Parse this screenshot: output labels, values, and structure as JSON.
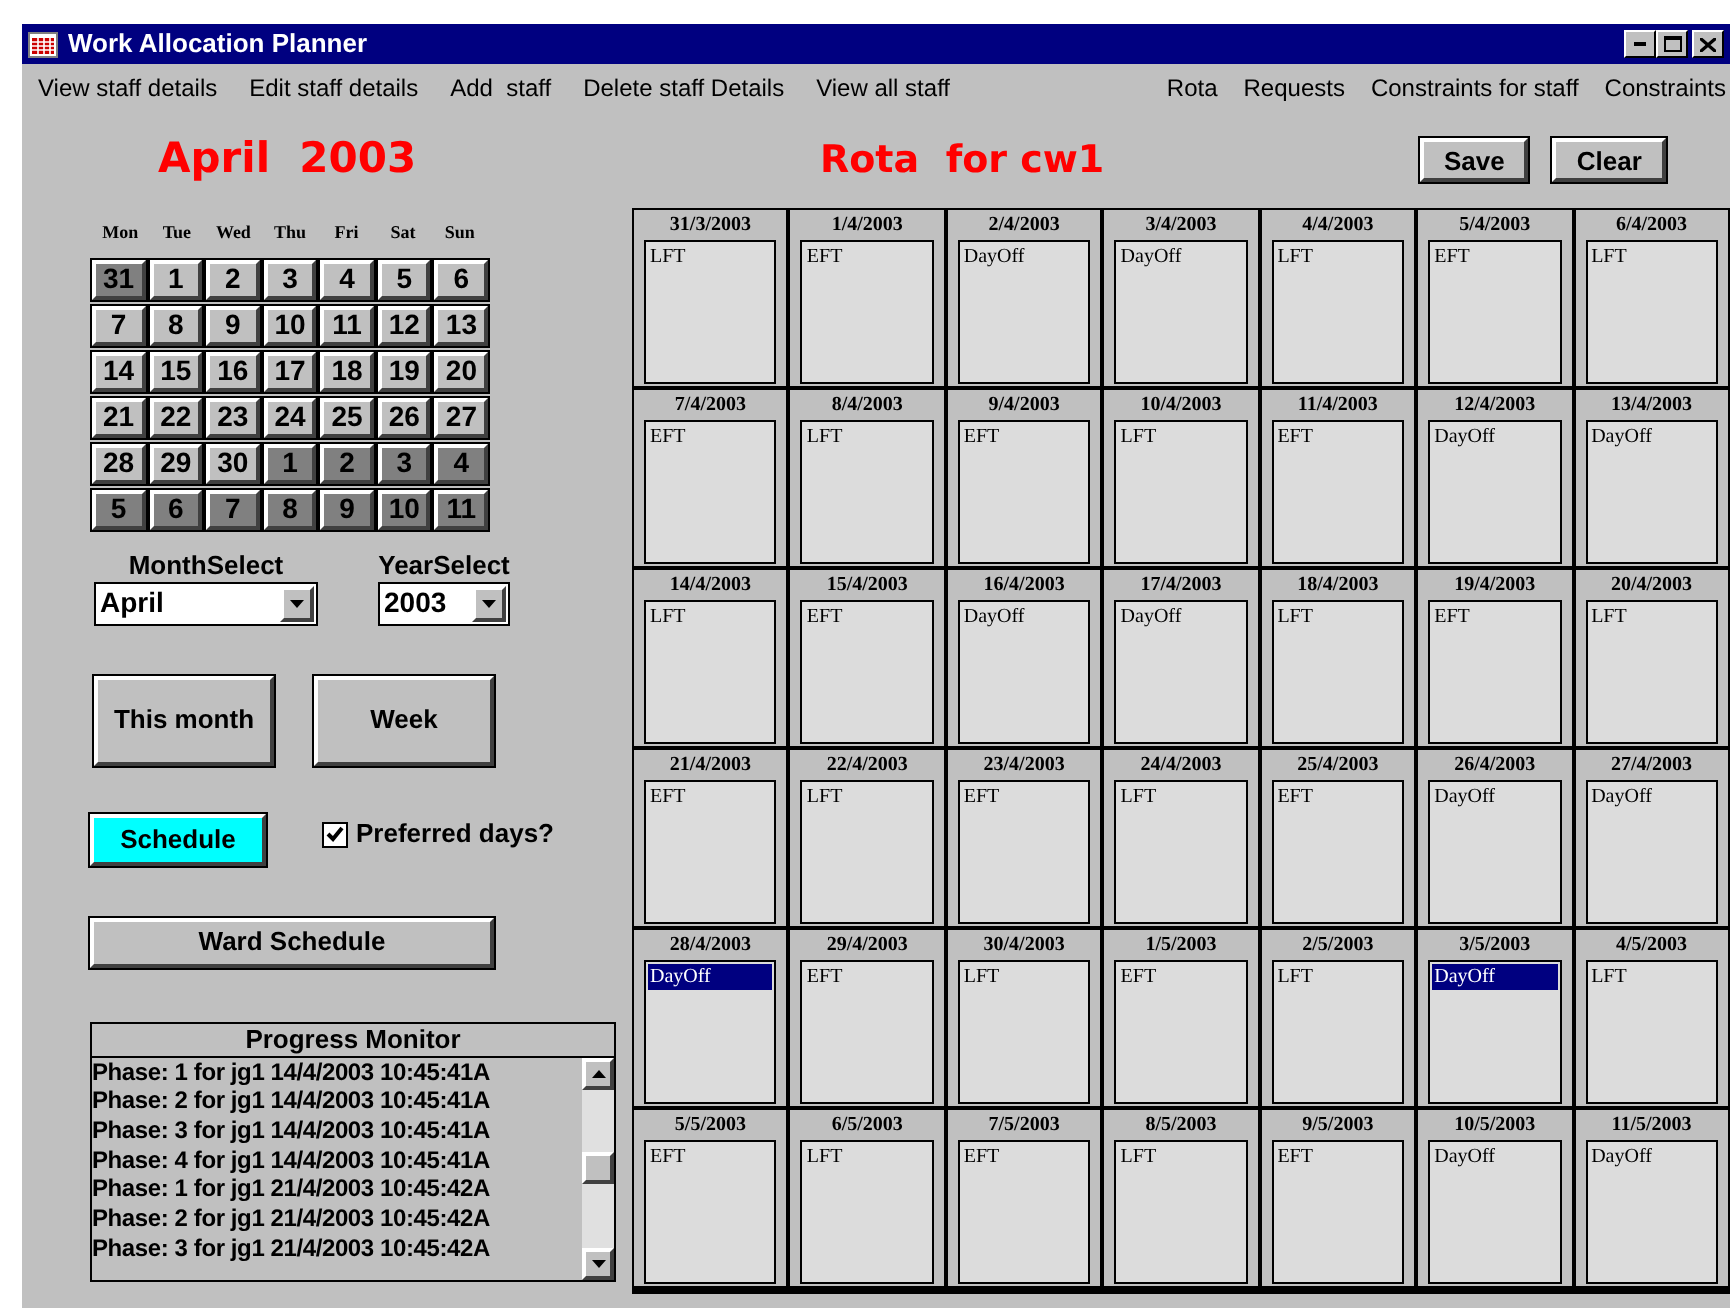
{
  "window": {
    "title": "Work Allocation Planner"
  },
  "menu_left": [
    "View staff details",
    "Edit staff details",
    "Add  staff",
    "Delete staff Details",
    "View all staff"
  ],
  "menu_right": [
    "Rota",
    "Requests",
    "Constraints for staff",
    "Constraints"
  ],
  "month_title": "April  2003",
  "rota_title": "Rota  for cw1",
  "actions": [
    "Save",
    "Clear"
  ],
  "weekdays": [
    "Mon",
    "Tue",
    "Wed",
    "Thu",
    "Fri",
    "Sat",
    "Sun"
  ],
  "days": [
    {
      "label": "31",
      "in_month": false
    },
    {
      "label": "1",
      "in_month": true
    },
    {
      "label": "2",
      "in_month": true
    },
    {
      "label": "3",
      "in_month": true
    },
    {
      "label": "4",
      "in_month": true
    },
    {
      "label": "5",
      "in_month": true
    },
    {
      "label": "6",
      "in_month": true
    },
    {
      "label": "7",
      "in_month": true
    },
    {
      "label": "8",
      "in_month": true
    },
    {
      "label": "9",
      "in_month": true
    },
    {
      "label": "10",
      "in_month": true
    },
    {
      "label": "11",
      "in_month": true
    },
    {
      "label": "12",
      "in_month": true
    },
    {
      "label": "13",
      "in_month": true
    },
    {
      "label": "14",
      "in_month": true
    },
    {
      "label": "15",
      "in_month": true
    },
    {
      "label": "16",
      "in_month": true
    },
    {
      "label": "17",
      "in_month": true
    },
    {
      "label": "18",
      "in_month": true
    },
    {
      "label": "19",
      "in_month": true
    },
    {
      "label": "20",
      "in_month": true
    },
    {
      "label": "21",
      "in_month": true
    },
    {
      "label": "22",
      "in_month": true
    },
    {
      "label": "23",
      "in_month": true
    },
    {
      "label": "24",
      "in_month": true
    },
    {
      "label": "25",
      "in_month": true
    },
    {
      "label": "26",
      "in_month": true
    },
    {
      "label": "27",
      "in_month": true
    },
    {
      "label": "28",
      "in_month": true
    },
    {
      "label": "29",
      "in_month": true
    },
    {
      "label": "30",
      "in_month": true
    },
    {
      "label": "1",
      "in_month": false
    },
    {
      "label": "2",
      "in_month": false
    },
    {
      "label": "3",
      "in_month": false
    },
    {
      "label": "4",
      "in_month": false
    },
    {
      "label": "5",
      "in_month": false
    },
    {
      "label": "6",
      "in_month": false
    },
    {
      "label": "7",
      "in_month": false
    },
    {
      "label": "8",
      "in_month": false
    },
    {
      "label": "9",
      "in_month": false
    },
    {
      "label": "10",
      "in_month": false
    },
    {
      "label": "11",
      "in_month": false
    }
  ],
  "month_select": {
    "label": "MonthSelect",
    "value": "April"
  },
  "year_select": {
    "label": "YearSelect",
    "value": "2003"
  },
  "view_buttons": [
    "This month",
    "Week"
  ],
  "schedule_button": "Schedule",
  "preferred_days": {
    "label": "Preferred days?",
    "checked": true
  },
  "ward_schedule_button": "Ward Schedule",
  "progress_monitor": {
    "title": "Progress Monitor",
    "lines": [
      "Phase: 1 for jg1 14/4/2003 10:45:41A",
      "Phase: 2 for jg1 14/4/2003 10:45:41A",
      "Phase: 3 for jg1 14/4/2003 10:45:41A",
      "Phase: 4 for jg1 14/4/2003 10:45:41A",
      "Phase: 1 for jg1 21/4/2003 10:45:42A",
      "Phase: 2 for jg1 21/4/2003 10:45:42A",
      "Phase: 3 for jg1 21/4/2003 10:45:42A"
    ]
  },
  "rota": [
    {
      "date": "31/3/2003",
      "shift": "LFT",
      "selected": false
    },
    {
      "date": "1/4/2003",
      "shift": "EFT",
      "selected": false
    },
    {
      "date": "2/4/2003",
      "shift": "DayOff",
      "selected": false
    },
    {
      "date": "3/4/2003",
      "shift": "DayOff",
      "selected": false
    },
    {
      "date": "4/4/2003",
      "shift": "LFT",
      "selected": false
    },
    {
      "date": "5/4/2003",
      "shift": "EFT",
      "selected": false
    },
    {
      "date": "6/4/2003",
      "shift": "LFT",
      "selected": false
    },
    {
      "date": "7/4/2003",
      "shift": "EFT",
      "selected": false
    },
    {
      "date": "8/4/2003",
      "shift": "LFT",
      "selected": false
    },
    {
      "date": "9/4/2003",
      "shift": "EFT",
      "selected": false
    },
    {
      "date": "10/4/2003",
      "shift": "LFT",
      "selected": false
    },
    {
      "date": "11/4/2003",
      "shift": "EFT",
      "selected": false
    },
    {
      "date": "12/4/2003",
      "shift": "DayOff",
      "selected": false
    },
    {
      "date": "13/4/2003",
      "shift": "DayOff",
      "selected": false
    },
    {
      "date": "14/4/2003",
      "shift": "LFT",
      "selected": false
    },
    {
      "date": "15/4/2003",
      "shift": "EFT",
      "selected": false
    },
    {
      "date": "16/4/2003",
      "shift": "DayOff",
      "selected": false
    },
    {
      "date": "17/4/2003",
      "shift": "DayOff",
      "selected": false
    },
    {
      "date": "18/4/2003",
      "shift": "LFT",
      "selected": false
    },
    {
      "date": "19/4/2003",
      "shift": "EFT",
      "selected": false
    },
    {
      "date": "20/4/2003",
      "shift": "LFT",
      "selected": false
    },
    {
      "date": "21/4/2003",
      "shift": "EFT",
      "selected": false
    },
    {
      "date": "22/4/2003",
      "shift": "LFT",
      "selected": false
    },
    {
      "date": "23/4/2003",
      "shift": "EFT",
      "selected": false
    },
    {
      "date": "24/4/2003",
      "shift": "LFT",
      "selected": false
    },
    {
      "date": "25/4/2003",
      "shift": "EFT",
      "selected": false
    },
    {
      "date": "26/4/2003",
      "shift": "DayOff",
      "selected": false
    },
    {
      "date": "27/4/2003",
      "shift": "DayOff",
      "selected": false
    },
    {
      "date": "28/4/2003",
      "shift": "DayOff",
      "selected": true
    },
    {
      "date": "29/4/2003",
      "shift": "EFT",
      "selected": false
    },
    {
      "date": "30/4/2003",
      "shift": "LFT",
      "selected": false
    },
    {
      "date": "1/5/2003",
      "shift": "EFT",
      "selected": false
    },
    {
      "date": "2/5/2003",
      "shift": "LFT",
      "selected": false
    },
    {
      "date": "3/5/2003",
      "shift": "DayOff",
      "selected": true
    },
    {
      "date": "4/5/2003",
      "shift": "LFT",
      "selected": false
    },
    {
      "date": "5/5/2003",
      "shift": "EFT",
      "selected": false
    },
    {
      "date": "6/5/2003",
      "shift": "LFT",
      "selected": false
    },
    {
      "date": "7/5/2003",
      "shift": "EFT",
      "selected": false
    },
    {
      "date": "8/5/2003",
      "shift": "LFT",
      "selected": false
    },
    {
      "date": "9/5/2003",
      "shift": "EFT",
      "selected": false
    },
    {
      "date": "10/5/2003",
      "shift": "DayOff",
      "selected": false
    },
    {
      "date": "11/5/2003",
      "shift": "DayOff",
      "selected": false
    }
  ]
}
